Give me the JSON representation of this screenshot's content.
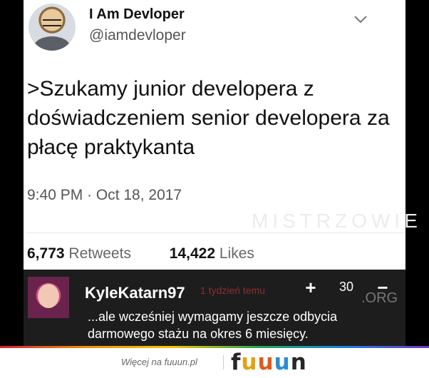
{
  "tweet": {
    "display_name": "I Am Devloper",
    "handle": "@iamdevloper",
    "text": ">Szukamy junior developera z doświadczeniem senior developera za płacę praktykanta",
    "timestamp": "9:40 PM · Oct 18, 2017",
    "retweets_count": "6,773",
    "retweets_label": "Retweets",
    "likes_count": "14,422",
    "likes_label": "Likes"
  },
  "watermark": "MISTRZOWIE",
  "comment": {
    "username": "KyleKatarn97",
    "time": "1 tydzień temu",
    "vote_plus": "+",
    "vote_count": "30",
    "vote_minus": "−",
    "org_tag": ".ORG",
    "line1": "...ale wcześniej wymagamy jeszcze odbycia",
    "line2": "darmowego stażu na okres 6 miesięcy."
  },
  "footer": {
    "more_text": "Więcej na fuuun.pl",
    "brand": [
      "f",
      "u",
      "u",
      "u",
      "n"
    ]
  },
  "icons": {
    "tweet_menu": "chevron-down-icon",
    "user_avatar": "avatar",
    "commenter_avatar": "avatar"
  }
}
